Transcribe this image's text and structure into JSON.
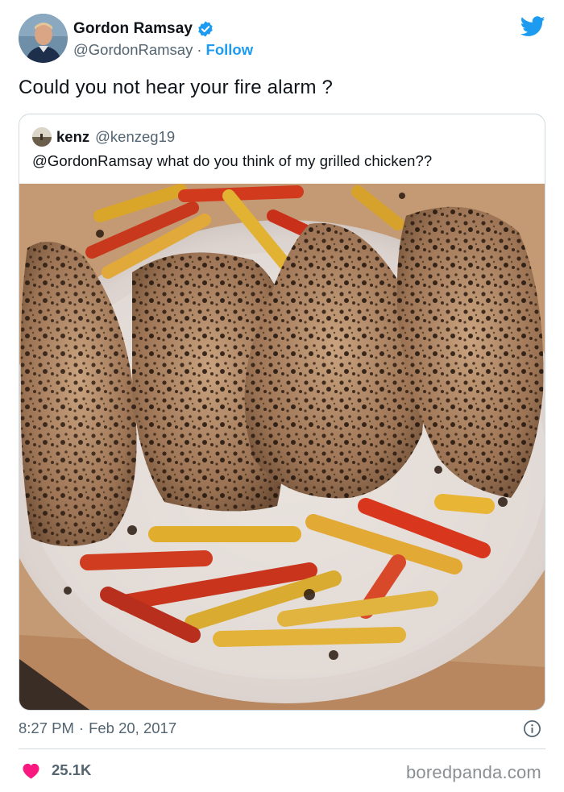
{
  "author": {
    "display_name": "Gordon Ramsay",
    "handle": "@GordonRamsay",
    "separator": "·",
    "follow_label": "Follow",
    "verified": true
  },
  "tweet": {
    "text": "Could you not hear your fire alarm ?",
    "time": "8:27 PM",
    "separator": "·",
    "date": "Feb 20, 2017",
    "likes": "25.1K"
  },
  "quoted_tweet": {
    "display_name": "kenz",
    "handle": "@kenzeg19",
    "text": "@GordonRamsay what do you think of my grilled chicken??",
    "photo_subject": "plate-of-grilled-chicken-with-peppers"
  },
  "icons": {
    "brand": "twitter-bird-icon",
    "verified": "verified-badge-icon",
    "info": "info-icon",
    "like": "heart-icon"
  },
  "colors": {
    "accent": "#1d9bf0",
    "secondary_text": "#536471",
    "like_red": "#f91880",
    "border": "#cfd9de"
  },
  "watermark": "boredpanda.com"
}
